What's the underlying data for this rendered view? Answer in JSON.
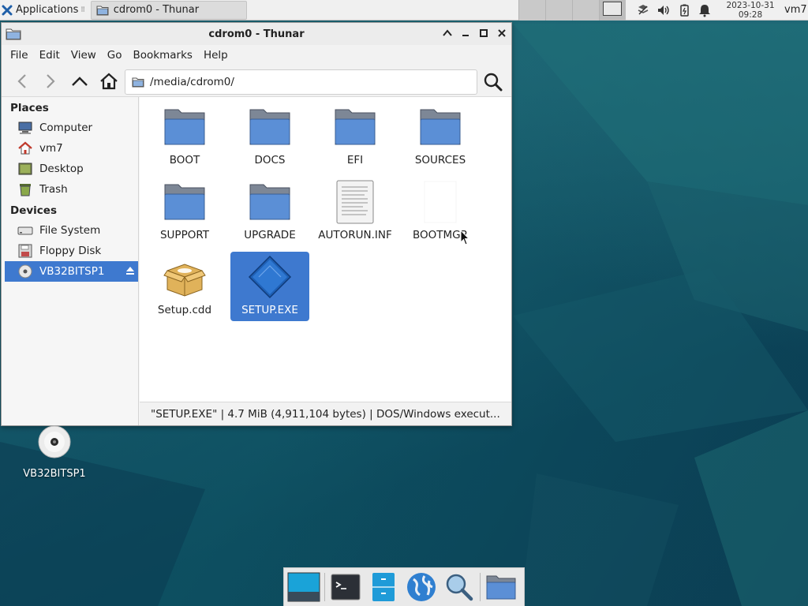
{
  "top_panel": {
    "applications_label": "Applications",
    "task_title": "cdrom0 - Thunar",
    "clock_date": "2023-10-31",
    "clock_time": "09:28",
    "user": "vm7"
  },
  "window": {
    "title": "cdrom0 - Thunar",
    "menu": [
      "File",
      "Edit",
      "View",
      "Go",
      "Bookmarks",
      "Help"
    ],
    "path": "/media/cdrom0/"
  },
  "sidebar": {
    "places_heading": "Places",
    "places": [
      "Computer",
      "vm7",
      "Desktop",
      "Trash"
    ],
    "devices_heading": "Devices",
    "devices": [
      "File System",
      "Floppy Disk",
      "VB32BITSP1"
    ]
  },
  "files": [
    {
      "name": "BOOT",
      "icon": "folder-icon"
    },
    {
      "name": "DOCS",
      "icon": "folder-icon"
    },
    {
      "name": "EFI",
      "icon": "folder-icon"
    },
    {
      "name": "SOURCES",
      "icon": "folder-icon"
    },
    {
      "name": "SUPPORT",
      "icon": "folder-icon"
    },
    {
      "name": "UPGRADE",
      "icon": "folder-icon"
    },
    {
      "name": "AUTORUN.INF",
      "icon": "text-file-icon"
    },
    {
      "name": "BOOTMGR",
      "icon": "blank-file-icon"
    },
    {
      "name": "Setup.cdd",
      "icon": "package-icon"
    },
    {
      "name": "SETUP.EXE",
      "icon": "executable-icon",
      "selected": true
    }
  ],
  "statusbar": "\"SETUP.EXE\"  |  4.7 MiB (4,911,104 bytes)  |  DOS/Windows execut...",
  "desktop": {
    "icon_label": "VB32BITSP1"
  },
  "colors": {
    "selection": "#3e79cf",
    "folder_blue": "#5b8fd6",
    "wallpaper": "#0f4a5e"
  }
}
